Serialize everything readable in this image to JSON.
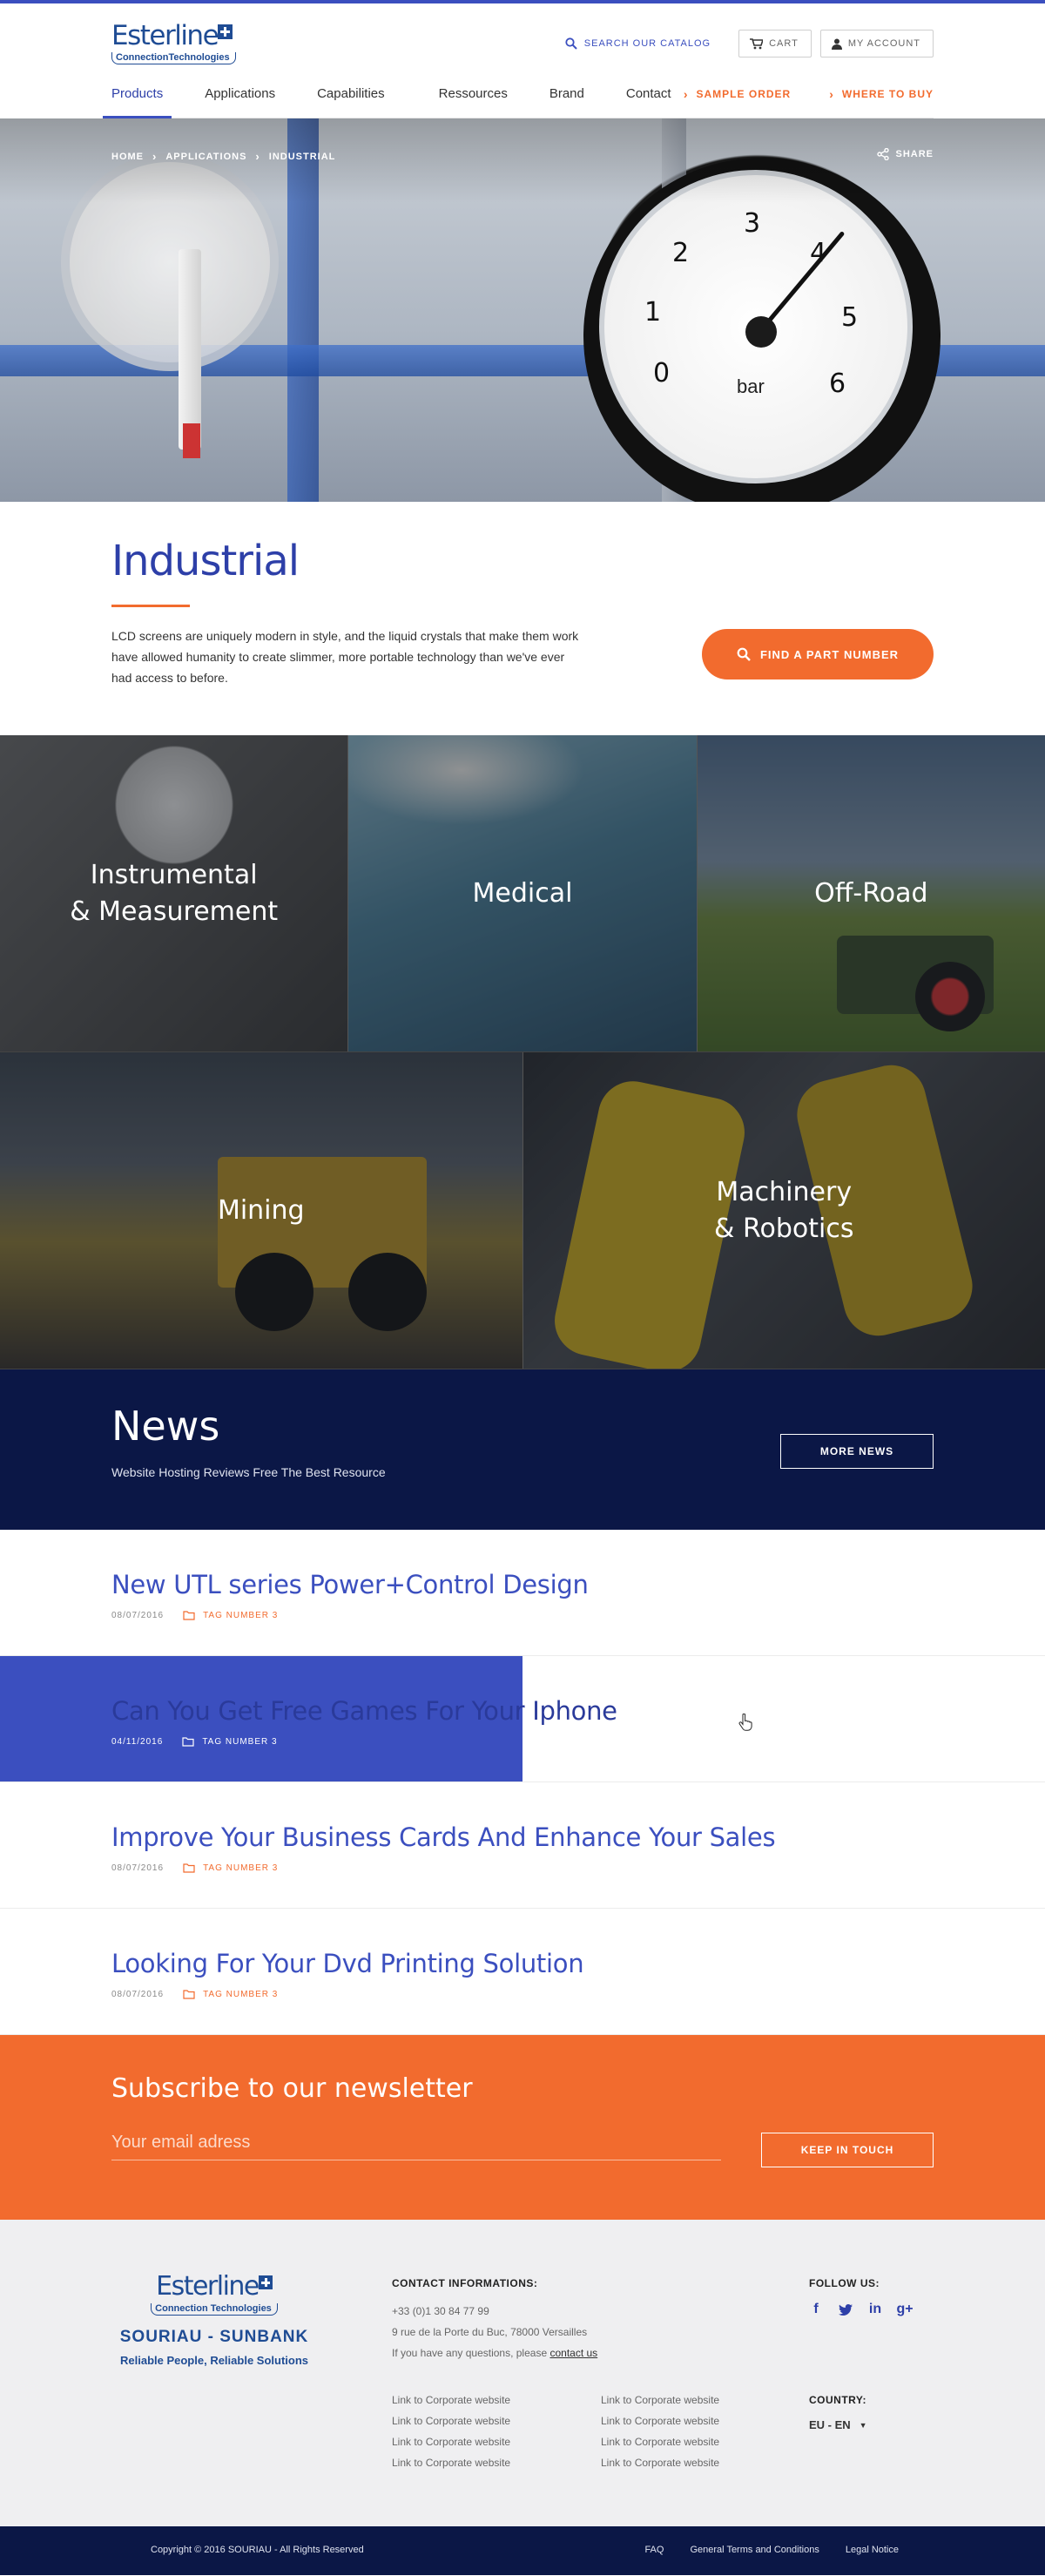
{
  "header": {
    "logo_brand": "Esterline",
    "logo_sub": "ConnectionTechnologies",
    "search_label": "SEARCH OUR CATALOG",
    "cart_label": "CART",
    "account_label": "MY ACCOUNT"
  },
  "nav": {
    "items": [
      "Products",
      "Applications",
      "Capabilities",
      "Ressources",
      "Brand",
      "Contact"
    ],
    "sample_order": "SAMPLE ORDER",
    "where_to_buy": "WHERE TO BUY"
  },
  "hero": {
    "breadcrumb": [
      "HOME",
      "APPLICATIONS",
      "INDUSTRIAL"
    ],
    "share_label": "SHARE"
  },
  "intro": {
    "title": "Industrial",
    "description": "LCD screens are uniquely modern in style, and the liquid crystals that make them work have allowed humanity to create slimmer, more portable technology than we've ever had access to before.",
    "find_button": "FIND A PART NUMBER"
  },
  "industries": {
    "row1": [
      "Instrumental\n& Measurement",
      "Medical",
      "Off-Road"
    ],
    "row2": [
      "Mining",
      "Machinery\n& Robotics"
    ]
  },
  "news": {
    "title": "News",
    "subtitle": "Website Hosting Reviews Free The Best Resource",
    "more_button": "MORE NEWS",
    "items": [
      {
        "title": "New UTL series Power+Control Design",
        "date": "08/07/2016",
        "tag": "TAG NUMBER 3"
      },
      {
        "title": "Can You Get Free Games For Your Iphone",
        "date": "04/11/2016",
        "tag": "TAG NUMBER 3"
      },
      {
        "title": "Improve Your Business Cards And Enhance Your Sales",
        "date": "08/07/2016",
        "tag": "TAG NUMBER 3"
      },
      {
        "title": "Looking For Your Dvd Printing Solution",
        "date": "08/07/2016",
        "tag": "TAG NUMBER 3"
      }
    ]
  },
  "newsletter": {
    "title": "Subscribe to our newsletter",
    "placeholder": "Your email adress",
    "button": "KEEP IN TOUCH"
  },
  "footer": {
    "logo_brand": "Esterline",
    "logo_sub": "Connection Technologies",
    "souriau": "SOURIAU - SUNBANK",
    "tagline": "Reliable People, Reliable Solutions",
    "contact_title": "CONTACT INFORMATIONS:",
    "phone": "+33 (0)1 30 84 77 99",
    "address": "9 rue de la Porte du Buc, 78000 Versailles",
    "question_text": "If you have any questions, please",
    "contact_link": "contact us",
    "links": [
      "Link to Corporate website",
      "Link to Corporate website",
      "Link to Corporate website",
      "Link to Corporate website",
      "Link to Corporate website",
      "Link to Corporate website",
      "Link to Corporate website",
      "Link to Corporate website"
    ],
    "follow_title": "FOLLOW US:",
    "social": [
      "facebook-icon",
      "twitter-icon",
      "linkedin-icon",
      "google-plus-icon"
    ],
    "country_title": "COUNTRY:",
    "country_value": "EU - EN"
  },
  "bottom": {
    "copyright": "Copyright © 2016 SOURIAU - All Rights Reserved",
    "legal": [
      "FAQ",
      "General Terms and Conditions",
      "Legal Notice"
    ]
  },
  "colors": {
    "accent_blue": "#3b4fbf",
    "navy": "#0b1746",
    "orange": "#f26b2e"
  }
}
